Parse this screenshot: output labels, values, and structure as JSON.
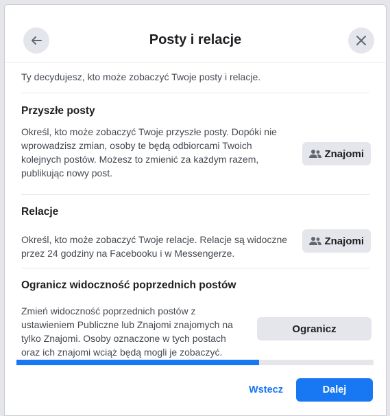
{
  "dialog": {
    "title": "Posty i relacje",
    "back_icon": "arrow-left-icon",
    "close_icon": "close-icon"
  },
  "intro": "Ty decydujesz, kto może zobaczyć Twoje posty i relacje.",
  "future_posts": {
    "title": "Przyszłe posty",
    "description_lines": [
      "Określ, kto może zobaczyć Twoje przyszłe posty. Dopóki nie",
      "wprowadzisz zmian, osoby te będą odbiorcami Twoich",
      "kolejnych postów. Możesz to zmienić za każdym razem,",
      "publikując nowy post."
    ],
    "audience_label": "Znajomi",
    "audience_icon": "friends-icon"
  },
  "stories": {
    "title": "Relacje",
    "description_lines": [
      "Określ, kto może zobaczyć Twoje relacje. Relacje są widoczne",
      "przez 24 godziny na Facebooku i w Messengerze."
    ],
    "audience_label": "Znajomi",
    "audience_icon": "friends-icon"
  },
  "limit_past": {
    "title": "Ogranicz widoczność poprzednich postów",
    "description_lines": [
      "Zmień widoczność poprzednich postów z",
      "ustawieniem Publiczne lub Znajomi znajomych na",
      "tylko Znajomi. Osoby oznaczone w tych postach",
      "oraz ich znajomi wciąż będą mogli je zobaczyć."
    ],
    "button_label": "Ogranicz"
  },
  "progress": {
    "fraction": 0.68
  },
  "footer": {
    "back_label": "Wstecz",
    "next_label": "Dalej"
  },
  "colors": {
    "accent": "#1877f2",
    "button_gray": "#e4e6eb"
  }
}
